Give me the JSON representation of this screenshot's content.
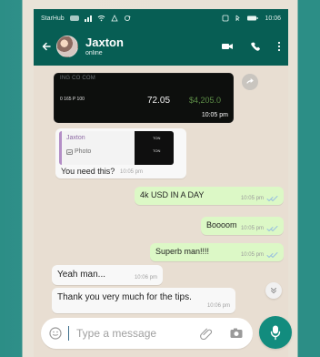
{
  "status_bar": {
    "carrier": "StarHub",
    "time": "10:06"
  },
  "header": {
    "contact_name": "Jaxton",
    "contact_status": "online"
  },
  "media_message": {
    "heading": "ING CO COM",
    "left_text": "0 165 P 100",
    "value": "72.05",
    "money": "$4,205.0",
    "time": "10:05 pm"
  },
  "reply_message": {
    "quoted_name": "Jaxton",
    "quoted_type": "Photo",
    "thumb_text_a": "TON",
    "thumb_text_b": "TON",
    "text": "You need this?",
    "time": "10:05 pm"
  },
  "messages": {
    "outgoing": [
      {
        "text": "4k USD IN A DAY",
        "time": "10:05 pm"
      },
      {
        "text": "Boooom",
        "time": "10:05 pm"
      },
      {
        "text": "Superb man!!!!",
        "time": "10:05 pm"
      }
    ],
    "incoming": [
      {
        "text": "Yeah man...",
        "time": "10:06 pm"
      },
      {
        "text": "Thank you very much for the tips.",
        "time": "10:06 pm"
      }
    ]
  },
  "composer": {
    "placeholder": "Type a message"
  },
  "colors": {
    "header": "#075e54",
    "accent": "#128c7e",
    "outgoing_bubble": "#dcf8c6",
    "incoming_bubble": "#f8f8f8",
    "chat_background": "#e8ded2"
  },
  "icons": {
    "back": "back-arrow-icon",
    "video": "video-call-icon",
    "call": "phone-call-icon",
    "menu": "more-vertical-icon",
    "forward": "forward-icon",
    "photo": "photo-icon",
    "scroll": "scroll-down-icon",
    "emoji": "emoji-icon",
    "attach": "attach-icon",
    "camera": "camera-icon",
    "mic": "mic-icon"
  }
}
